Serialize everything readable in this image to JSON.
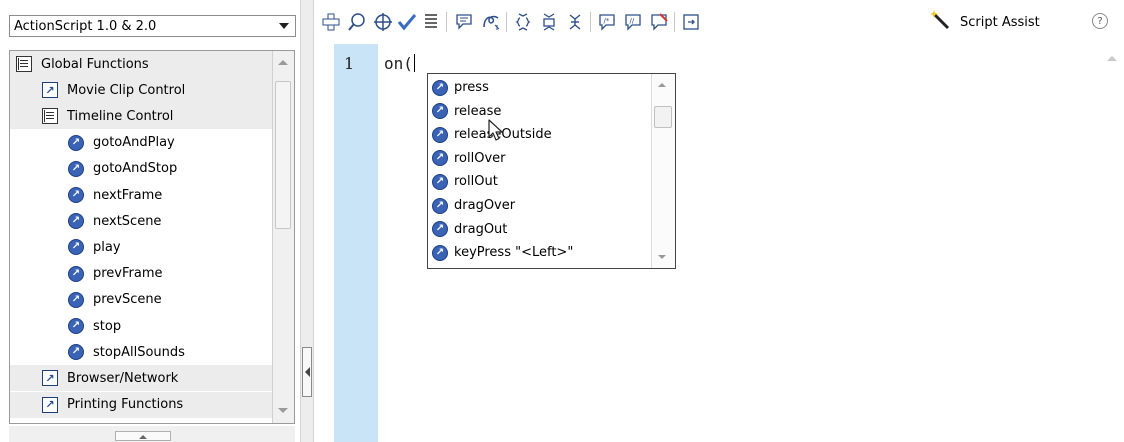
{
  "version_select": {
    "value": "ActionScript 1.0 & 2.0"
  },
  "tree": {
    "items": [
      {
        "label": "Global Functions",
        "icon": "book-icon",
        "level": 0
      },
      {
        "label": "Movie Clip Control",
        "icon": "blue-book-icon",
        "level": 1
      },
      {
        "label": "Timeline Control",
        "icon": "book-icon",
        "level": 1
      },
      {
        "label": "gotoAndPlay",
        "icon": "function-icon",
        "level": 2
      },
      {
        "label": "gotoAndStop",
        "icon": "function-icon",
        "level": 2
      },
      {
        "label": "nextFrame",
        "icon": "function-icon",
        "level": 2
      },
      {
        "label": "nextScene",
        "icon": "function-icon",
        "level": 2
      },
      {
        "label": "play",
        "icon": "function-icon",
        "level": 2
      },
      {
        "label": "prevFrame",
        "icon": "function-icon",
        "level": 2
      },
      {
        "label": "prevScene",
        "icon": "function-icon",
        "level": 2
      },
      {
        "label": "stop",
        "icon": "function-icon",
        "level": 2
      },
      {
        "label": "stopAllSounds",
        "icon": "function-icon",
        "level": 2
      },
      {
        "label": "Browser/Network",
        "icon": "blue-book-icon",
        "level": 1
      },
      {
        "label": "Printing Functions",
        "icon": "blue-book-icon",
        "level": 1
      }
    ]
  },
  "toolbar": {
    "buttons": [
      "add-item-icon",
      "find-icon",
      "target-icon",
      "check-syntax-icon",
      "auto-format-icon",
      "code-hint-icon",
      "debug-options-icon",
      "collapse-braces-icon",
      "collapse-selection-icon",
      "expand-all-icon",
      "apply-block-comment-icon",
      "apply-line-comment-icon",
      "remove-comment-icon",
      "show-hide-toolbox-icon"
    ],
    "script_assist_label": "Script Assist",
    "help_label": "?"
  },
  "editor": {
    "line_number": "1",
    "code": "on("
  },
  "popup": {
    "items": [
      "press",
      "release",
      "releaseOutside",
      "rollOver",
      "rollOut",
      "dragOver",
      "dragOut",
      "keyPress \"<Left>\""
    ]
  },
  "colors": {
    "gutter": "#c9e4f7",
    "function_icon": "#3a63b5",
    "tree_shade": "#ececec"
  }
}
